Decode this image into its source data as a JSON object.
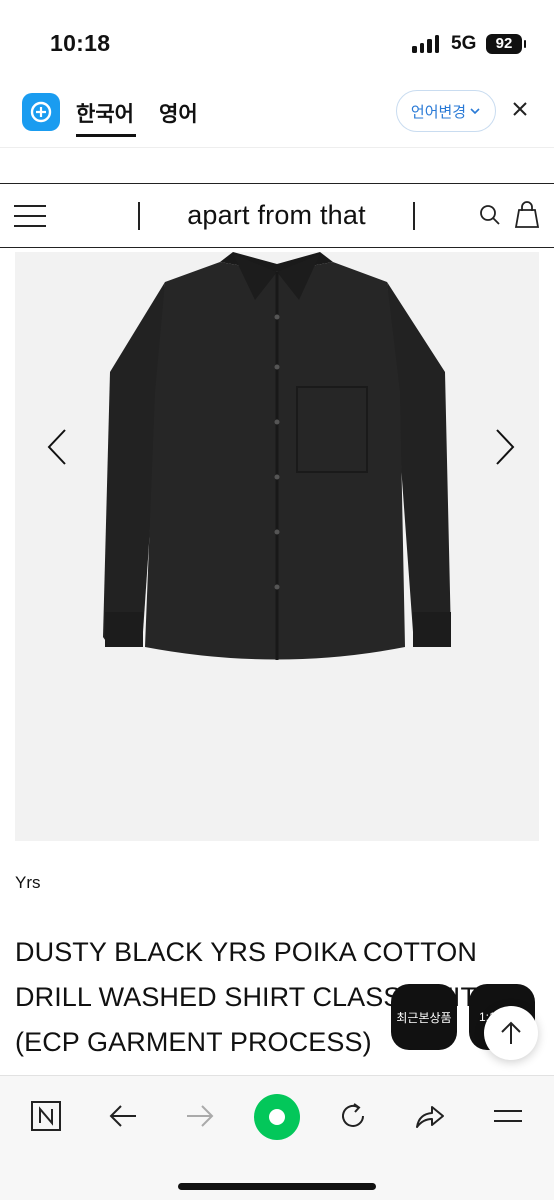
{
  "status_bar": {
    "time": "10:18",
    "network": "5G",
    "battery": "92"
  },
  "translate_bar": {
    "tab_korean": "한국어",
    "tab_english": "영어",
    "change_language": "언어변경",
    "close_icon": "close-icon"
  },
  "site_header": {
    "title": "apart from that",
    "icons": [
      "menu-icon",
      "search-icon",
      "shopping-bag-icon"
    ]
  },
  "product": {
    "brand": "Yrs",
    "title": "DUSTY BLACK YRS POIKA COTTON DRILL WASHED SHIRT CLASSIC FIT (ECP GARMENT PROCESS)",
    "image_alt": "black shirt"
  },
  "floating": {
    "recent_label": "최근본상품",
    "chat_label": "1:1"
  },
  "bottom_bar": {
    "icons": [
      "naver-n-icon",
      "back-arrow-icon",
      "forward-arrow-icon",
      "green-dot-icon",
      "reload-icon",
      "share-icon",
      "menu-icon"
    ]
  },
  "colors": {
    "accent_blue": "#1a9cf0",
    "naver_green": "#03c75a"
  }
}
